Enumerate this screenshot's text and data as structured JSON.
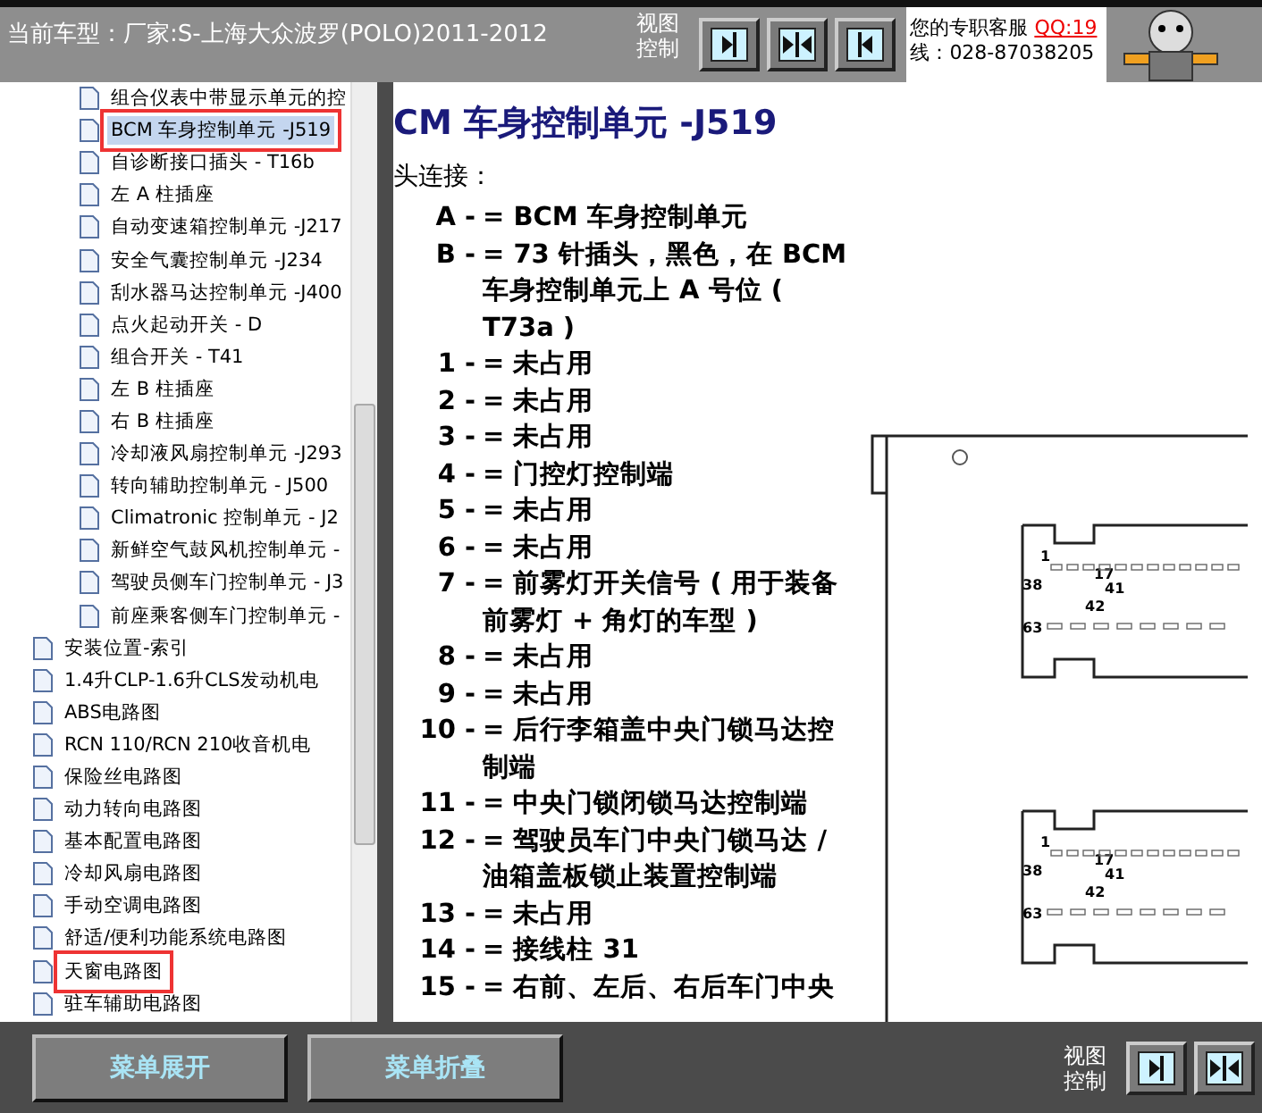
{
  "top_bar": {
    "title": "当前车型：厂家:S-上海大众波罗(POLO)2011-2012",
    "view_label": "视图控制",
    "view_buttons": [
      {
        "kind": "right"
      },
      {
        "kind": "split"
      },
      {
        "kind": "left"
      }
    ],
    "service_label": "您的专职客服",
    "service_qq": "QQ:19",
    "service_phone": "线：028-87038205"
  },
  "tree": {
    "items": [
      {
        "children": [
          {
            "label": "组合仪表中带显示单元的控",
            "selected": false,
            "marked": false
          },
          {
            "label": "BCM 车身控制单元 -J519",
            "selected": true,
            "marked": true
          },
          {
            "label": "自诊断接口插头 - T16b",
            "selected": false,
            "marked": false
          },
          {
            "label": "左 A 柱插座",
            "selected": false,
            "marked": false
          },
          {
            "label": "自动变速箱控制单元 -J217",
            "selected": false,
            "marked": false
          },
          {
            "label": "安全气囊控制单元 -J234",
            "selected": false,
            "marked": false
          },
          {
            "label": "刮水器马达控制单元 -J400",
            "selected": false,
            "marked": false
          },
          {
            "label": "点火起动开关 - D",
            "selected": false,
            "marked": false
          },
          {
            "label": "组合开关 - T41",
            "selected": false,
            "marked": false
          },
          {
            "label": "左 B 柱插座",
            "selected": false,
            "marked": false
          },
          {
            "label": "右 B 柱插座",
            "selected": false,
            "marked": false
          },
          {
            "label": "冷却液风扇控制单元 -J293",
            "selected": false,
            "marked": false
          },
          {
            "label": "转向辅助控制单元 - J500",
            "selected": false,
            "marked": false
          },
          {
            "label": "Climatronic 控制单元 - J2",
            "selected": false,
            "marked": false
          },
          {
            "label": "新鲜空气鼓风机控制单元 -",
            "selected": false,
            "marked": false
          },
          {
            "label": "驾驶员侧车门控制单元 - J3",
            "selected": false,
            "marked": false
          },
          {
            "label": "前座乘客侧车门控制单元 -",
            "selected": false,
            "marked": false
          }
        ]
      },
      {
        "label": "安装位置-索引",
        "selected": false,
        "marked": false
      },
      {
        "label": "1.4升CLP-1.6升CLS发动机电",
        "selected": false,
        "marked": false
      },
      {
        "label": "ABS电路图",
        "selected": false,
        "marked": false
      },
      {
        "label": "RCN 110/RCN 210收音机电",
        "selected": false,
        "marked": false
      },
      {
        "label": "保险丝电路图",
        "selected": false,
        "marked": false
      },
      {
        "label": "动力转向电路图",
        "selected": false,
        "marked": false
      },
      {
        "label": "基本配置电路图",
        "selected": false,
        "marked": false
      },
      {
        "label": "冷却风扇电路图",
        "selected": false,
        "marked": false
      },
      {
        "label": "手动空调电路图",
        "selected": false,
        "marked": false
      },
      {
        "label": "舒适/便利功能系统电路图",
        "selected": false,
        "marked": false
      },
      {
        "label": "天窗电路图",
        "selected": false,
        "marked": true
      },
      {
        "label": "驻车辅助电路图",
        "selected": false,
        "marked": false
      }
    ]
  },
  "document": {
    "title": "CM 车身控制单元 -J519",
    "subtitle": "头连接：",
    "entries": [
      {
        "key": "A -",
        "text": "= BCM 车身控制单元"
      },
      {
        "key": "B -",
        "text": "= 73 针插头，黑色，在 BCM 车身控制单元上 A 号位 ( T73a )"
      },
      {
        "key": "1 -",
        "text": "= 未占用"
      },
      {
        "key": "2 -",
        "text": "= 未占用"
      },
      {
        "key": "3 -",
        "text": "= 未占用"
      },
      {
        "key": "4 -",
        "text": "= 门控灯控制端"
      },
      {
        "key": "5 -",
        "text": "= 未占用"
      },
      {
        "key": "6 -",
        "text": "= 未占用"
      },
      {
        "key": "7 -",
        "text": "= 前雾灯开关信号 ( 用于装备前雾灯 + 角灯的车型 )"
      },
      {
        "key": "8 -",
        "text": "= 未占用"
      },
      {
        "key": "9 -",
        "text": "= 未占用"
      },
      {
        "key": "10 -",
        "text": "= 后行李箱盖中央门锁马达控制端"
      },
      {
        "key": "11 -",
        "text": "= 中央门锁闭锁马达控制端"
      },
      {
        "key": "12 -",
        "text": "= 驾驶员车门中央门锁马达 / 油箱盖板锁止装置控制端"
      },
      {
        "key": "13 -",
        "text": "= 未占用"
      },
      {
        "key": "14 -",
        "text": "= 接线柱 31"
      },
      {
        "key": "15 -",
        "text": "= 右前、左后、右后车门中央"
      }
    ],
    "diagram_pins": [
      [
        "1",
        "17",
        "38",
        "41",
        "42",
        "63"
      ],
      [
        "1",
        "17",
        "38",
        "41",
        "42",
        "63"
      ]
    ]
  },
  "bottom_bar": {
    "buttons": [
      "菜单展开",
      "菜单折叠"
    ],
    "view_label": "视图控制",
    "view_buttons": [
      {
        "kind": "right"
      },
      {
        "kind": "split"
      }
    ]
  }
}
